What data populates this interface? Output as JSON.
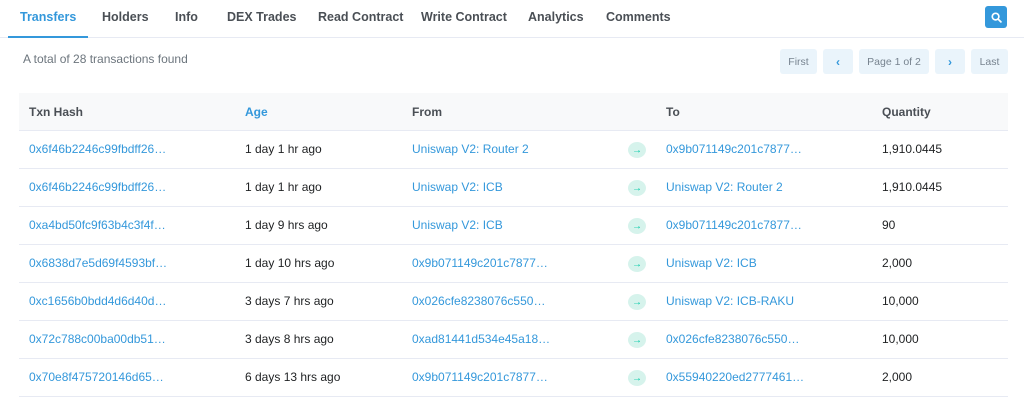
{
  "tabs": [
    {
      "label": "Transfers",
      "active": true
    },
    {
      "label": "Holders"
    },
    {
      "label": "Info"
    },
    {
      "label": "DEX Trades"
    },
    {
      "label": "Read Contract"
    },
    {
      "label": "Write Contract"
    },
    {
      "label": "Analytics"
    },
    {
      "label": "Comments"
    }
  ],
  "search_icon": "search-icon",
  "summary": "A total of 28 transactions found",
  "pager": {
    "first": "First",
    "prev": "‹",
    "page": "Page 1 of 2",
    "next": "›",
    "last": "Last"
  },
  "table": {
    "headers": {
      "hash": "Txn Hash",
      "age": "Age",
      "from": "From",
      "to": "To",
      "qty": "Quantity"
    },
    "rows": [
      {
        "hash": "0x6f46b2246c99fbdff26…",
        "age": "1 day 1 hr ago",
        "from": "Uniswap V2: Router 2",
        "to": "0x9b071149c201c7877…",
        "qty": "1,910.0445"
      },
      {
        "hash": "0x6f46b2246c99fbdff26…",
        "age": "1 day 1 hr ago",
        "from": "Uniswap V2: ICB",
        "to": "Uniswap V2: Router 2",
        "qty": "1,910.0445"
      },
      {
        "hash": "0xa4bd50fc9f63b4c3f4f…",
        "age": "1 day 9 hrs ago",
        "from": "Uniswap V2: ICB",
        "to": "0x9b071149c201c7877…",
        "qty": "90"
      },
      {
        "hash": "0x6838d7e5d69f4593bf…",
        "age": "1 day 10 hrs ago",
        "from": "0x9b071149c201c7877…",
        "to": "Uniswap V2: ICB",
        "qty": "2,000"
      },
      {
        "hash": "0xc1656b0bdd4d6d40d…",
        "age": "3 days 7 hrs ago",
        "from": "0x026cfe8238076c550…",
        "to": "Uniswap V2: ICB-RAKU",
        "qty": "10,000"
      },
      {
        "hash": "0x72c788c00ba00db51…",
        "age": "3 days 8 hrs ago",
        "from": "0xad81441d534e45a18…",
        "to": "0x026cfe8238076c550…",
        "qty": "10,000"
      },
      {
        "hash": "0x70e8f475720146d65…",
        "age": "6 days 13 hrs ago",
        "from": "0x9b071149c201c7877…",
        "to": "0x55940220ed2777461…",
        "qty": "2,000"
      }
    ],
    "arrow_glyph": "→"
  },
  "colors": {
    "accent": "#3498db",
    "arrow_green": "#00c9a7",
    "arrow_bg": "#d6f3ec"
  }
}
